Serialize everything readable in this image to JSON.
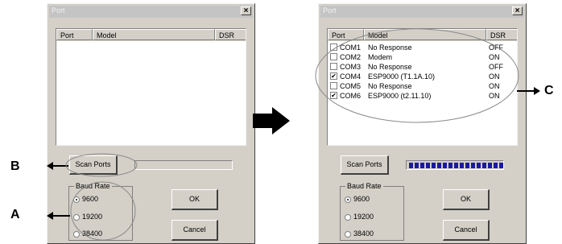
{
  "window_title": "Port",
  "close_glyph": "×",
  "columns": {
    "port": "Port",
    "model": "Model",
    "dsr": "DSR"
  },
  "ports_after_scan": [
    {
      "checked": false,
      "port": "COM1",
      "model": "No Response",
      "dsr": "OFF"
    },
    {
      "checked": false,
      "port": "COM2",
      "model": "Modem",
      "dsr": "ON"
    },
    {
      "checked": false,
      "port": "COM3",
      "model": "No Response",
      "dsr": "OFF"
    },
    {
      "checked": true,
      "port": "COM4",
      "model": "ESP9000 (T1.1A.10)",
      "dsr": "ON"
    },
    {
      "checked": false,
      "port": "COM5",
      "model": "No Response",
      "dsr": "ON"
    },
    {
      "checked": true,
      "port": "COM6",
      "model": "ESP9000 (t2.11.10)",
      "dsr": "ON"
    }
  ],
  "scan_button": "Scan Ports",
  "baud_rate": {
    "label": "Baud Rate",
    "options": [
      "9600",
      "19200",
      "38400"
    ],
    "selected": "9600"
  },
  "ok_button": "OK",
  "cancel_button": "Cancel",
  "progress_before": 0.0,
  "progress_after": 1.0,
  "progress_color": "#1a1aa0",
  "annotations": {
    "a": "A",
    "b": "B",
    "c": "C"
  }
}
